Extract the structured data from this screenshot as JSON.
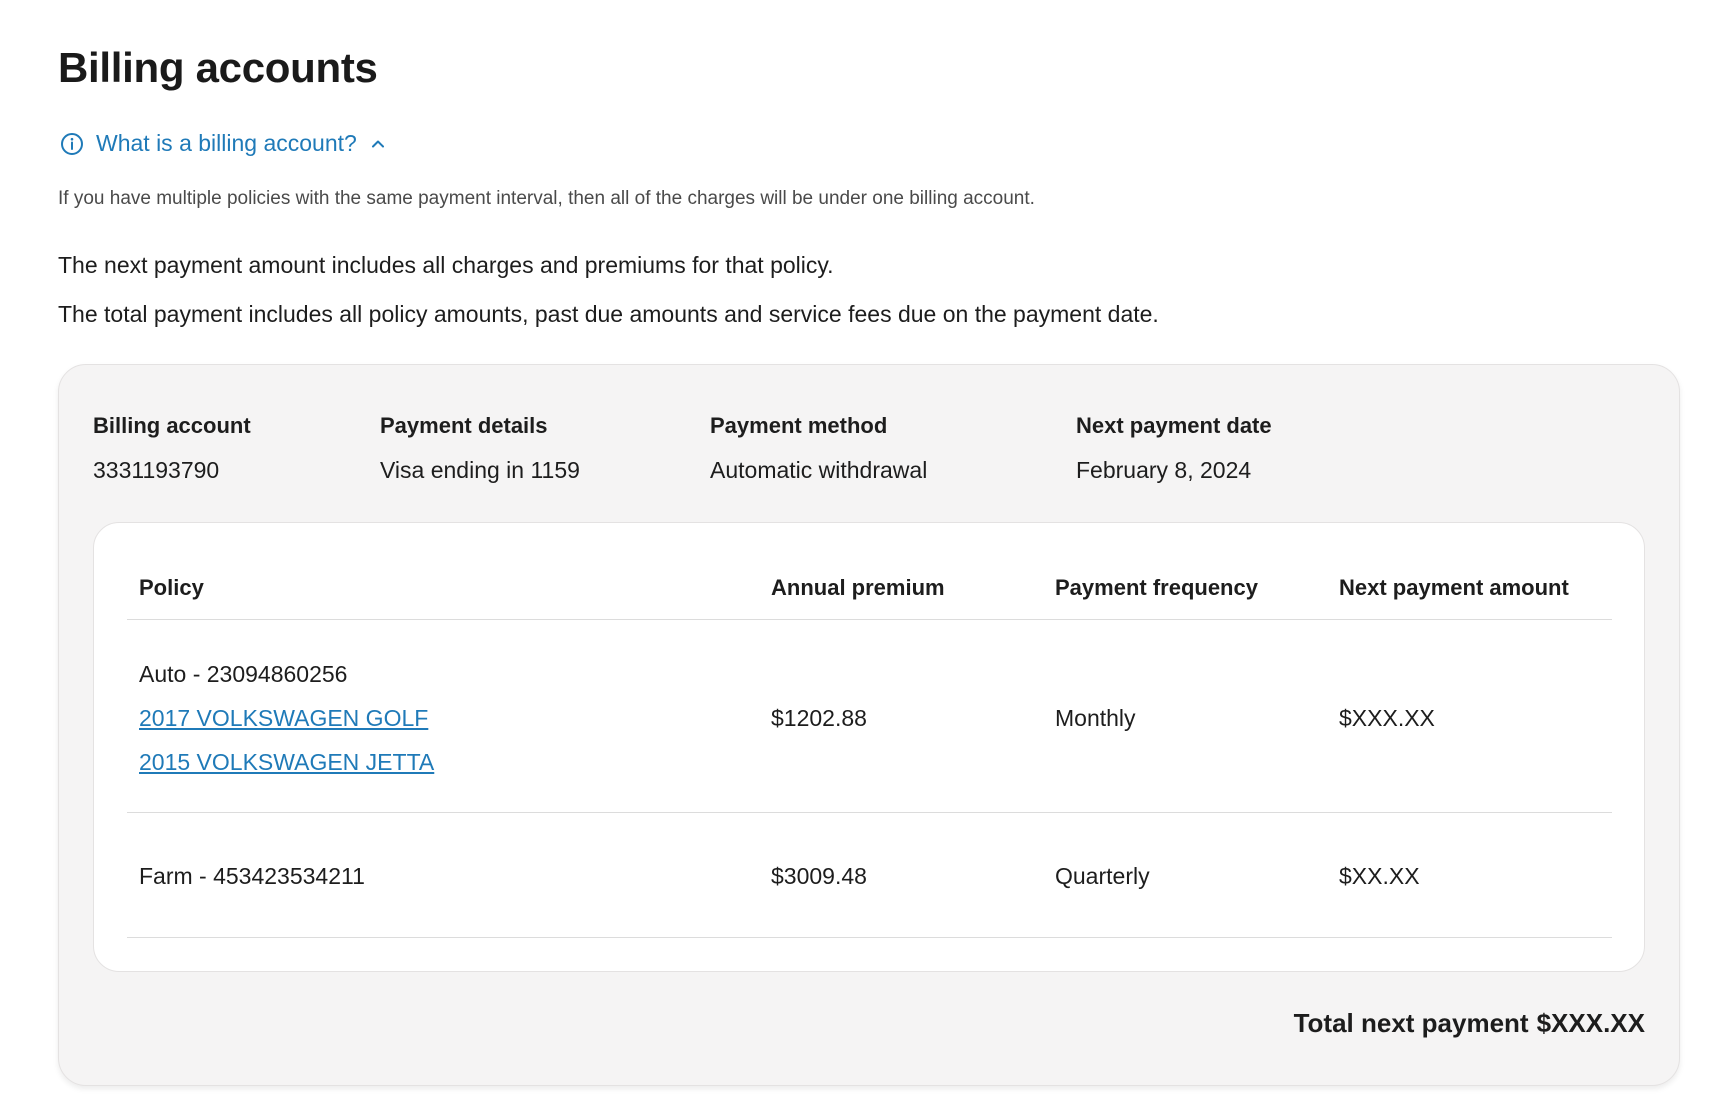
{
  "page": {
    "title": "Billing accounts",
    "info_toggle_label": "What is a billing account?",
    "info_text": "If you have multiple policies with the same payment interval, then all of the charges will be under one billing account.",
    "paragraph_1": "The next payment amount includes all charges and premiums for that policy.",
    "paragraph_2": "The total payment includes all policy amounts, past due amounts and service fees due on the payment date."
  },
  "account": {
    "billing_account_label": "Billing account",
    "billing_account_value": "3331193790",
    "payment_details_label": "Payment details",
    "payment_details_value": "Visa ending in 1159",
    "payment_method_label": "Payment method",
    "payment_method_value": "Automatic withdrawal",
    "next_payment_date_label": "Next payment date",
    "next_payment_date_value": "February 8, 2024"
  },
  "table": {
    "headers": {
      "policy": "Policy",
      "annual_premium": "Annual premium",
      "payment_frequency": "Payment frequency",
      "next_payment_amount": "Next payment amount"
    },
    "rows": [
      {
        "policy": "Auto - 23094860256",
        "vehicles": [
          "2017 VOLKSWAGEN GOLF",
          "2015 VOLKSWAGEN JETTA"
        ],
        "annual_premium": "$1202.88",
        "payment_frequency": "Monthly",
        "next_payment_amount": "$XXX.XX"
      },
      {
        "policy": "Farm - 453423534211",
        "annual_premium": "$3009.48",
        "payment_frequency": "Quarterly",
        "next_payment_amount": "$XX.XX"
      }
    ]
  },
  "total": {
    "label": "Total next payment",
    "amount": "$XXX.XX"
  },
  "icons": {
    "info": "info-circle-icon",
    "toggle": "chevron-up-icon"
  },
  "colors": {
    "link": "#1f7ab8",
    "card_background": "#f5f4f4"
  }
}
